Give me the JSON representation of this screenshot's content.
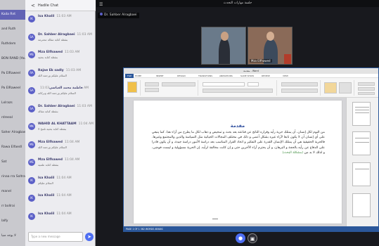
{
  "names_column": {
    "rows": [
      {
        "label": "Kaila Rnt",
        "selected": true
      },
      {
        "label": "and Ruth",
        "selected": false
      },
      {
        "label": "Ruthdem",
        "selected": false
      },
      {
        "label": "BON RAND (You)",
        "selected": false
      },
      {
        "label": "Pa ElRaweel",
        "selected": false
      },
      {
        "label": "Pa ElRaweel",
        "selected": false
      },
      {
        "label": "Lxlrazs",
        "selected": false
      },
      {
        "label": "rdreeal",
        "selected": false
      },
      {
        "label": "Saher Alragbaei",
        "selected": false
      },
      {
        "label": "Rawa Elfaedl",
        "selected": false
      },
      {
        "label": "Sat",
        "selected": false
      },
      {
        "label": "rinaa rra Soltrash",
        "selected": false
      },
      {
        "label": "manel",
        "selected": false
      },
      {
        "label": "rr bollrai",
        "selected": false
      },
      {
        "label": "lalfy",
        "selected": false
      },
      {
        "label": "لا يوجد منيا",
        "selected": false
      }
    ]
  },
  "chat": {
    "back_label": "<",
    "header_title": "Hadile Chat",
    "messages": [
      {
        "initials": "IK",
        "name": "Isa Khalil",
        "time": "11:03 AM",
        "text": ""
      },
      {
        "initials": "SA",
        "name": "Dr. Sahber Alragbaei",
        "time": "11:03 AM",
        "text": "بنقطة كتابة مقالة محترمة"
      },
      {
        "initials": "ME",
        "name": "Mza Elfhawed",
        "time": "11:03 AM",
        "text": "بنقطة كتابة بحثية"
      },
      {
        "initials": "RA",
        "name": "Rajae Ek sadly",
        "time": "11:03 AM",
        "text": "السلام عليكم ورحمة الله"
      },
      {
        "initials": "SA",
        "name": "فاطمة محمد العباسي",
        "time": "11:03 AM",
        "text": "السلام عليكم ورحمة الله وبركاته"
      },
      {
        "initials": "SA",
        "name": "Dr. Sahber Alragbaei",
        "time": "11:03 AM",
        "text": "بنقطة كتابة مقالة"
      },
      {
        "initials": "MK",
        "name": "WAHID AL KHATTAAM",
        "time": "11:04 AM",
        "text": "بنقطة كتابة بحثية تلمح لا"
      },
      {
        "initials": "ME",
        "name": "Mza Elfhawed",
        "time": "11:04 AM",
        "text": "السلام عليكم ورحمة الله"
      },
      {
        "initials": "ME",
        "name": "Mza Elfhawed",
        "time": "11:04 AM",
        "text": "بنقطة كتابة علمية"
      },
      {
        "initials": "IK",
        "name": "Isa Khalil",
        "time": "11:04 AM",
        "text": "السلام عليكم"
      },
      {
        "initials": "IK",
        "name": "Isa Khalil",
        "time": "11:04 AM",
        "text": ""
      },
      {
        "initials": "IK",
        "name": "Isa Khalil",
        "time": "11:04 AM",
        "text": ""
      }
    ],
    "input_placeholder": "Type a new message",
    "send_icon": "send-icon"
  },
  "meeting": {
    "top_text": "جلسة مهارات التحدث",
    "presenter_tag": "Dr. Sahber Alragbaei",
    "videos": [
      {
        "label": ""
      },
      {
        "label": "Mza Elfhawed"
      }
    ]
  },
  "word": {
    "title": "مقدمة - Word",
    "tabs": [
      "FILE",
      "HOME",
      "INSERT",
      "DESIGN",
      "TRANSITIONS",
      "ANIMATIONS",
      "SLIDE SHOW",
      "REVIEW",
      "VIEW"
    ],
    "doc_heading": "مقدمة",
    "doc_body": "من اليوم لكل إنسان، أن يمتلك حرية رأيه وقراره الناتج عن قناعته بعد بحث و تمحيص و ذهاب لكل ما يطرح من آراء هذا. كما ينبغي على أي إنسان أن لا يكون تابعا لآراء غيره بشكل أعمى و ذلك في مختلف المجالات الحياتية مثل السياسة والدين والمجتمع وغيرها. فالحرية الحقيقية هي أن يمتلك الإنسان القدرة على التفكير و اتخاذ القرار المناسب بعد دراسة الأمور دراسة جيدة، و أن يكون قادرا على الدفاع عن رأيه بالحجة و البرهان، و أن يحترم آراء الآخرين حتى و إن كانت مخالفة لرأيه. إن الحرية مسؤولية و ليست فوضى، و لذلك لا بد من",
    "doc_body_green": "(مشكلة البحث)",
    "status_text": "PAGE 1 OF 1   382 WORDS   ARABIC"
  },
  "controls": {
    "mic_icon": "mic-icon",
    "share_icon": "share-icon"
  },
  "colors": {
    "teams_purple": "#6263b5",
    "word_blue": "#2b579a",
    "heading_blue": "#2e4e9e",
    "mic_blue": "#4e6ef2"
  }
}
